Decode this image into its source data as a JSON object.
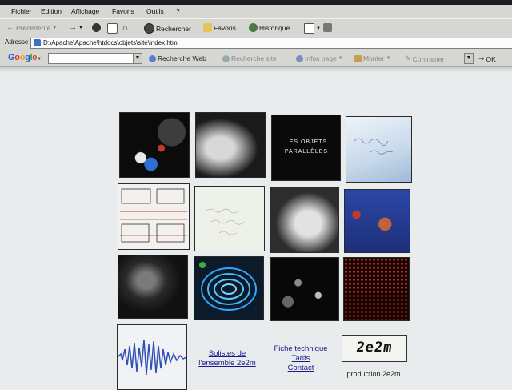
{
  "menu": [
    "Fichier",
    "Edition",
    "Affichage",
    "Favoris",
    "Outils",
    "?"
  ],
  "toolbar": {
    "back": "Précédente",
    "search": "Rechercher",
    "favorites": "Favoris",
    "history": "Historique"
  },
  "address": {
    "label": "Adresse",
    "url": "D:\\Apache\\Apache\\htdocs\\objets\\site\\index.html"
  },
  "google_bar": {
    "logo": "Google",
    "web_search": "Recherche Web",
    "site_search": "Recherche site",
    "page_info": "Infos page",
    "up": "Monter",
    "contrast": "Contraster",
    "ok": "OK"
  },
  "grid": {
    "title_tile_text": "LES OBJETS PARALLÈLES"
  },
  "links": {
    "soloists": "Solistes de l'ensemble 2e2m",
    "tech_sheet": "Fiche technique",
    "rates": "Tarifs",
    "contact": "Contact"
  },
  "production": "production 2e2m",
  "logo_text": "2e2m",
  "colors": {
    "chrome": "#d6d7d2",
    "page_bg": "#e9ecec",
    "link": "#1a1a8c"
  }
}
